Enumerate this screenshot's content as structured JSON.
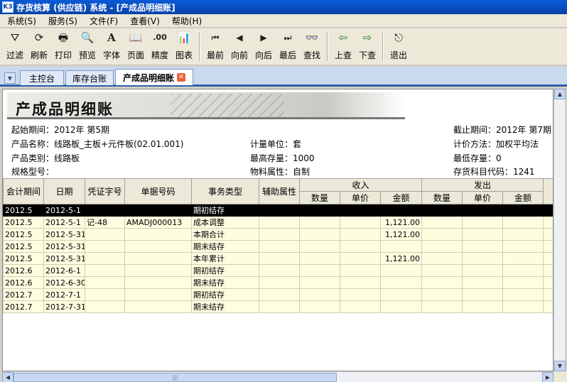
{
  "window": {
    "title": "存货核算 (供应链) 系统 - [产成品明细账]",
    "icon_text": "K3"
  },
  "menu": [
    "系统(S)",
    "服务(S)",
    "文件(F)",
    "查看(V)",
    "帮助(H)"
  ],
  "toolbar": [
    {
      "label": "过滤",
      "icon": "filter-icon",
      "glyph": "⛛"
    },
    {
      "label": "刷新",
      "icon": "refresh-icon",
      "glyph": "⟳"
    },
    {
      "label": "打印",
      "icon": "print-icon",
      "glyph": "🖶"
    },
    {
      "label": "预览",
      "icon": "preview-icon",
      "glyph": "🔍"
    },
    {
      "label": "字体",
      "icon": "font-icon",
      "glyph": "A"
    },
    {
      "label": "页面",
      "icon": "page-icon",
      "glyph": "📖"
    },
    {
      "label": "精度",
      "icon": "precision-icon",
      "glyph": ".00"
    },
    {
      "label": "图表",
      "icon": "chart-icon",
      "glyph": "📊"
    },
    {
      "label": "最前",
      "icon": "first-icon",
      "glyph": "⏮"
    },
    {
      "label": "向前",
      "icon": "prev-icon",
      "glyph": "◀"
    },
    {
      "label": "向后",
      "icon": "next-icon",
      "glyph": "▶"
    },
    {
      "label": "最后",
      "icon": "last-icon",
      "glyph": "⏭"
    },
    {
      "label": "查找",
      "icon": "find-icon",
      "glyph": "👓"
    },
    {
      "label": "上查",
      "icon": "lookup-up-icon",
      "glyph": "⇦"
    },
    {
      "label": "下查",
      "icon": "lookup-down-icon",
      "glyph": "⇨"
    },
    {
      "label": "退出",
      "icon": "exit-icon",
      "glyph": "⎋"
    }
  ],
  "tabs": [
    "主控台",
    "库存台账",
    "产成品明细账"
  ],
  "report": {
    "title": "产成品明细账",
    "start_period": "起始期间：2012年 第5期",
    "end_period": "截止期间：2012年 第7期",
    "product_name": "产品名称：线路板_主板+元件板(02.01.001)",
    "unit": "计量单位：套",
    "costing": "计价方法：加权平均法",
    "category": "产品类别：线路板",
    "max_stock": "最高存量：1000",
    "min_stock": "最低存量：0",
    "spec": "规格型号：",
    "material_attr": "物料属性：自制",
    "account_code": "存货科目代码：1241"
  },
  "grid": {
    "headers": [
      "会计期间",
      "日期",
      "凭证字号",
      "单据号码",
      "事务类型",
      "辅助属性"
    ],
    "group_in": "收入",
    "group_out": "发出",
    "sub_headers": [
      "数量",
      "单价",
      "金额",
      "数量",
      "单价",
      "金额"
    ],
    "rows": [
      [
        "2012.5",
        "2012-5-1",
        "",
        "",
        "期初结存",
        "",
        "",
        "",
        "",
        "",
        "",
        ""
      ],
      [
        "2012.5",
        "2012-5-1",
        "记-48",
        "AMADJ000013",
        "成本调整",
        "",
        "",
        "",
        "1,121.00",
        "",
        "",
        ""
      ],
      [
        "2012.5",
        "2012-5-31",
        "",
        "",
        "本期合计",
        "",
        "",
        "",
        "1,121.00",
        "",
        "",
        ""
      ],
      [
        "2012.5",
        "2012-5-31",
        "",
        "",
        "期末结存",
        "",
        "",
        "",
        "",
        "",
        "",
        ""
      ],
      [
        "2012.5",
        "2012-5-31",
        "",
        "",
        "本年累计",
        "",
        "",
        "",
        "1,121.00",
        "",
        "",
        ""
      ],
      [
        "2012.6",
        "2012-6-1",
        "",
        "",
        "期初结存",
        "",
        "",
        "",
        "",
        "",
        "",
        ""
      ],
      [
        "2012.6",
        "2012-6-30",
        "",
        "",
        "期末结存",
        "",
        "",
        "",
        "",
        "",
        "",
        ""
      ],
      [
        "2012.7",
        "2012-7-1",
        "",
        "",
        "期初结存",
        "",
        "",
        "",
        "",
        "",
        "",
        ""
      ],
      [
        "2012.7",
        "2012-7-31",
        "",
        "",
        "期末结存",
        "",
        "",
        "",
        "",
        "",
        "",
        ""
      ]
    ],
    "selected_row": 0
  },
  "colors": {
    "title_bar": "#0a5ad6",
    "row_bg": "#fffde0",
    "selected_row": "#000000",
    "tab_accent": "#2f5fa8"
  }
}
